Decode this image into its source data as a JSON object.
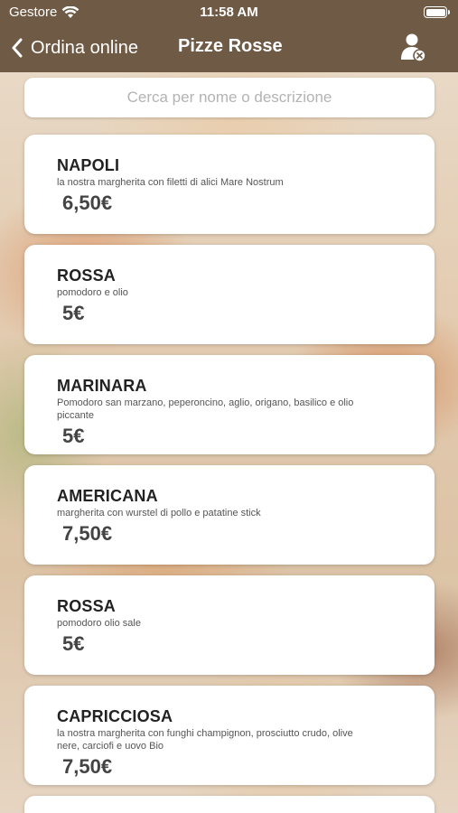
{
  "status_bar": {
    "carrier": "Gestore",
    "time": "11:58 AM",
    "wifi_icon": "wifi-icon",
    "battery_icon": "battery-icon"
  },
  "nav": {
    "back_label": "Ordina online",
    "title": "Pizze Rosse",
    "user_icon": "user-remove-icon"
  },
  "colors": {
    "header_bg": "#6f5a45",
    "card_bg": "#ffffff",
    "placeholder": "#b3b3b3"
  },
  "search": {
    "placeholder": "Cerca per nome o descrizione",
    "value": ""
  },
  "menu": {
    "items": [
      {
        "name": "NAPOLI",
        "description": "la nostra margherita con filetti di alici Mare Nostrum",
        "price": "6,50€"
      },
      {
        "name": "ROSSA",
        "description": "pomodoro e olio",
        "price": "5€"
      },
      {
        "name": "MARINARA",
        "description": "Pomodoro san marzano, peperoncino, aglio, origano, basilico e olio piccante",
        "price": "5€"
      },
      {
        "name": "AMERICANA",
        "description": "margherita con wurstel di pollo e patatine stick",
        "price": "7,50€"
      },
      {
        "name": "ROSSA",
        "description": "pomodoro olio sale",
        "price": "5€"
      },
      {
        "name": "CAPRICCIOSA",
        "description": "la nostra margherita con funghi champignon, prosciutto crudo, olive nere, carciofi e uovo Bio",
        "price": "7,50€"
      }
    ]
  }
}
